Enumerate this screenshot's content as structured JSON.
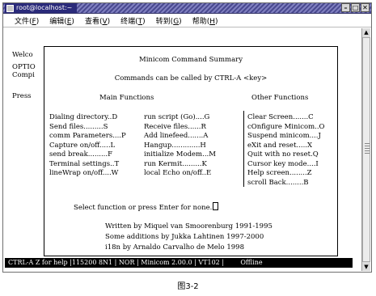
{
  "window": {
    "title": "root@localhost:~",
    "minimize": "–",
    "maximize": "□",
    "close": "✕"
  },
  "menu": [
    {
      "label": "文件(",
      "key": "F",
      "end": ")"
    },
    {
      "label": "编辑(",
      "key": "E",
      "end": ")"
    },
    {
      "label": "查看(",
      "key": "V",
      "end": ")"
    },
    {
      "label": "终端(",
      "key": "T",
      "end": ")"
    },
    {
      "label": "转到(",
      "key": "G",
      "end": ")"
    },
    {
      "label": "帮助(",
      "key": "H",
      "end": ")"
    }
  ],
  "terminal": {
    "side_lines": [
      "Welco",
      "OPTIO",
      "Compi",
      "Press"
    ],
    "summary_title": "Minicom Command Summary",
    "called_by": "Commands can be called by CTRL-A <key>",
    "main_heading": "Main Functions",
    "other_heading": "Other Functions",
    "rows": [
      {
        "a": "Dialing directory..D",
        "b": "run script (Go)....G",
        "c": "Clear Screen.......C"
      },
      {
        "a": "Send files.........S",
        "b": "Receive files......R",
        "c": "cOnfigure Minicom..O"
      },
      {
        "a": "comm Parameters....P",
        "b": "Add linefeed.......A",
        "c": "Suspend minicom....J"
      },
      {
        "a": "Capture on/off.....L",
        "b": "Hangup.............H",
        "c": "eXit and reset.....X"
      },
      {
        "a": "send break.........F",
        "b": "initialize Modem...M",
        "c": "Quit with no reset.Q"
      },
      {
        "a": "Terminal settings..T",
        "b": "run Kermit.........K",
        "c": "Cursor key mode....I"
      },
      {
        "a": "lineWrap on/off....W",
        "b": "local Echo on/off..E",
        "c": "Help screen........Z"
      },
      {
        "a": "",
        "b": "",
        "c": "scroll Back........B"
      }
    ],
    "select_prompt": "Select function or press Enter for none.",
    "credits": [
      "Written by Miquel van Smoorenburg 1991-1995",
      "Some additions by Jukka Lahtinen 1997-2000",
      "i18n by Arnaldo Carvalho de Melo 1998"
    ]
  },
  "status_bar": "CTRL-A Z for help |115200 8N1 | NOR | Minicom 2.00.0 | VT102 |        Offline",
  "caption": "图3-2"
}
